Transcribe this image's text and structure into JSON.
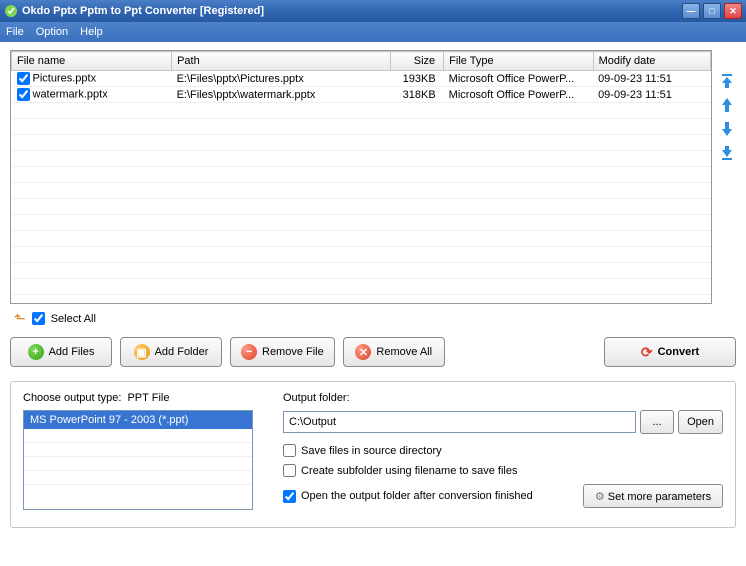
{
  "window": {
    "title": "Okdo Pptx Pptm to Ppt Converter [Registered]"
  },
  "menu": {
    "file": "File",
    "option": "Option",
    "help": "Help"
  },
  "table": {
    "headers": {
      "name": "File name",
      "path": "Path",
      "size": "Size",
      "type": "File Type",
      "date": "Modify date"
    },
    "rows": [
      {
        "checked": true,
        "name": "Pictures.pptx",
        "path": "E:\\Files\\pptx\\Pictures.pptx",
        "size": "193KB",
        "type": "Microsoft Office PowerP...",
        "date": "09-09-23 11:51"
      },
      {
        "checked": true,
        "name": "watermark.pptx",
        "path": "E:\\Files\\pptx\\watermark.pptx",
        "size": "318KB",
        "type": "Microsoft Office PowerP...",
        "date": "09-09-23 11:51"
      }
    ]
  },
  "select_all": "Select All",
  "buttons": {
    "add_files": "Add Files",
    "add_folder": "Add Folder",
    "remove_file": "Remove File",
    "remove_all": "Remove All",
    "convert": "Convert",
    "browse": "...",
    "open": "Open",
    "more_params": "Set more parameters"
  },
  "output": {
    "choose_label": "Choose output type:",
    "choose_value": "PPT File",
    "type_option": "MS PowerPoint 97 - 2003 (*.ppt)",
    "folder_label": "Output folder:",
    "folder_value": "C:\\Output",
    "opt_save_src": "Save files in source directory",
    "opt_create_sub": "Create subfolder using filename to save files",
    "opt_open_after": "Open the output folder after conversion finished"
  }
}
